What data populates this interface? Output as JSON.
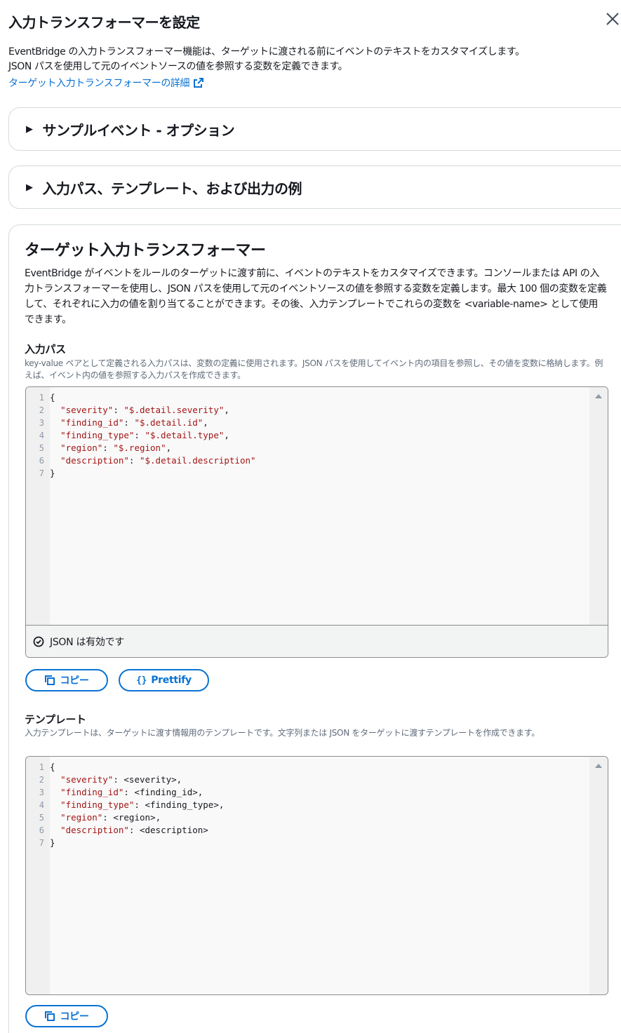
{
  "modal": {
    "title": "入力トランスフォーマーを設定",
    "intro_line1": "EventBridge の入力トランスフォーマー機能は、ターゲットに渡される前にイベントのテキストをカスタマイズします。",
    "intro_line2": "JSON パスを使用して元のイベントソースの値を参照する変数を定義できます。",
    "learn_more_link": "ターゲット入力トランスフォーマーの詳細"
  },
  "sections": {
    "sample_event": "サンプルイベント - オプション",
    "examples": "入力パス、テンプレート、および出力の例"
  },
  "transformer": {
    "title": "ターゲット入力トランスフォーマー",
    "description": "EventBridge がイベントをルールのターゲットに渡す前に、イベントのテキストをカスタマイズできます。コンソールまたは API の入力トランスフォーマーを使用し、JSON パスを使用して元のイベントソースの値を参照する変数を定義します。最大 100 個の変数を定義して、それぞれに入力の値を割り当てることができます。その後、入力テンプレートでこれらの変数を <variable-name> として使用できます。",
    "input_path": {
      "label": "入力パス",
      "description": "key-value ペアとして定義される入力パスは、変数の定義に使用されます。JSON パスを使用してイベント内の項目を参照し、その値を変数に格納します。例えば、イベント内の値を参照する入力パスを作成できます。",
      "lines": [
        {
          "n": "1",
          "key": "",
          "sep": "",
          "val": "{",
          "trail": ""
        },
        {
          "n": "2",
          "key": "\"severity\"",
          "sep": ": ",
          "val": "\"$.detail.severity\"",
          "trail": ","
        },
        {
          "n": "3",
          "key": "\"finding_id\"",
          "sep": ": ",
          "val": "\"$.detail.id\"",
          "trail": ","
        },
        {
          "n": "4",
          "key": "\"finding_type\"",
          "sep": ": ",
          "val": "\"$.detail.type\"",
          "trail": ","
        },
        {
          "n": "5",
          "key": "\"region\"",
          "sep": ": ",
          "val": "\"$.region\"",
          "trail": ","
        },
        {
          "n": "6",
          "key": "\"description\"",
          "sep": ": ",
          "val": "\"$.detail.description\"",
          "trail": ""
        },
        {
          "n": "7",
          "key": "",
          "sep": "",
          "val": "}",
          "trail": ""
        }
      ],
      "status": "JSON は有効です",
      "copy_button": "コピー",
      "prettify_button": "Prettify"
    },
    "template": {
      "label": "テンプレート",
      "description": "入力テンプレートは、ターゲットに渡す情報用のテンプレートです。文字列または JSON をターゲットに渡すテンプレートを作成できます。",
      "lines": [
        {
          "n": "1",
          "key": "",
          "sep": "",
          "val": "{",
          "trail": ""
        },
        {
          "n": "2",
          "key": "\"severity\"",
          "sep": ": ",
          "val": "<severity>",
          "trail": ","
        },
        {
          "n": "3",
          "key": "\"finding_id\"",
          "sep": ": ",
          "val": "<finding_id>",
          "trail": ","
        },
        {
          "n": "4",
          "key": "\"finding_type\"",
          "sep": ": ",
          "val": "<finding_type>",
          "trail": ","
        },
        {
          "n": "5",
          "key": "\"region\"",
          "sep": ": ",
          "val": "<region>",
          "trail": ","
        },
        {
          "n": "6",
          "key": "\"description\"",
          "sep": ": ",
          "val": "<description>",
          "trail": ""
        },
        {
          "n": "7",
          "key": "",
          "sep": "",
          "val": "}",
          "trail": ""
        }
      ],
      "copy_button": "コピー"
    }
  },
  "colors": {
    "link": "#0972d3",
    "json_key": "#a31515",
    "json_string": "#a31515"
  },
  "icons": {
    "close": "close-icon",
    "external": "external-link-icon",
    "caret": "caret-right-icon",
    "status": "check-circle-icon",
    "copy": "copy-icon"
  }
}
